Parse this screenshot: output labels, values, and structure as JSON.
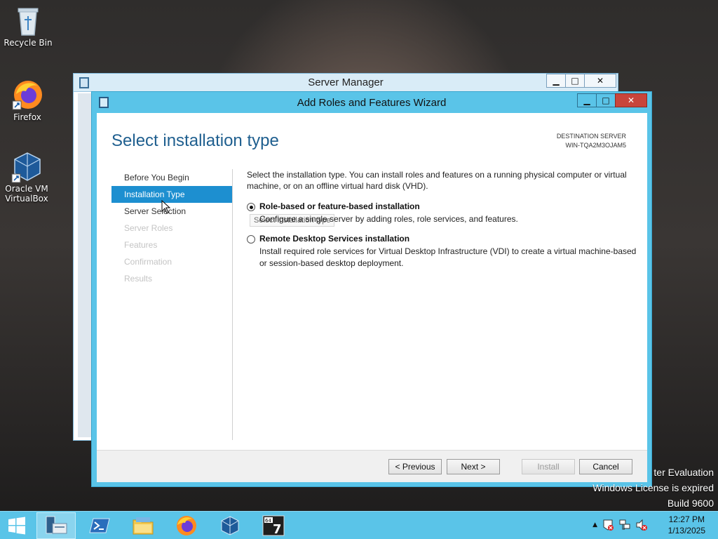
{
  "desktop": {
    "icons": [
      {
        "label": "Recycle Bin",
        "icon": "recycle-bin-icon"
      },
      {
        "label": "Firefox",
        "icon": "firefox-icon"
      },
      {
        "label": "Oracle VM VirtualBox",
        "icon": "virtualbox-icon"
      }
    ],
    "watermark": [
      "ter Evaluation",
      "Windows License is expired",
      "Build 9600"
    ]
  },
  "server_manager": {
    "title": "Server Manager"
  },
  "wizard": {
    "title": "Add Roles and Features Wizard",
    "heading": "Select installation type",
    "destination_label": "DESTINATION SERVER",
    "destination_server": "WIN-TQA2M3OJAM5",
    "steps": [
      {
        "label": "Before You Begin",
        "state": "normal"
      },
      {
        "label": "Installation Type",
        "state": "active"
      },
      {
        "label": "Server Selection",
        "state": "normal"
      },
      {
        "label": "Server Roles",
        "state": "disabled"
      },
      {
        "label": "Features",
        "state": "disabled"
      },
      {
        "label": "Confirmation",
        "state": "disabled"
      },
      {
        "label": "Results",
        "state": "disabled"
      }
    ],
    "tooltip": "Select installation type",
    "intro": "Select the installation type. You can install roles and features on a running physical computer or virtual machine, or on an offline virtual hard disk (VHD).",
    "options": [
      {
        "label": "Role-based or feature-based installation",
        "description": "Configure a single server by adding roles, role services, and features.",
        "checked": true
      },
      {
        "label": "Remote Desktop Services installation",
        "description": "Install required role services for Virtual Desktop Infrastructure (VDI) to create a virtual machine-based or session-based desktop deployment.",
        "checked": false
      }
    ],
    "buttons": {
      "previous": "< Previous",
      "next": "Next >",
      "install": "Install",
      "cancel": "Cancel"
    }
  },
  "taskbar": {
    "items": [
      "start-button",
      "server-manager-icon",
      "powershell-icon",
      "file-explorer-icon",
      "firefox-icon",
      "virtualbox-icon",
      "7zip-icon"
    ],
    "clock_time": "12:27 PM",
    "clock_date": "1/13/2025"
  },
  "colors": {
    "accent": "#5ac4e8",
    "selected_step": "#1d8fd0",
    "heading": "#1f5f8f"
  }
}
